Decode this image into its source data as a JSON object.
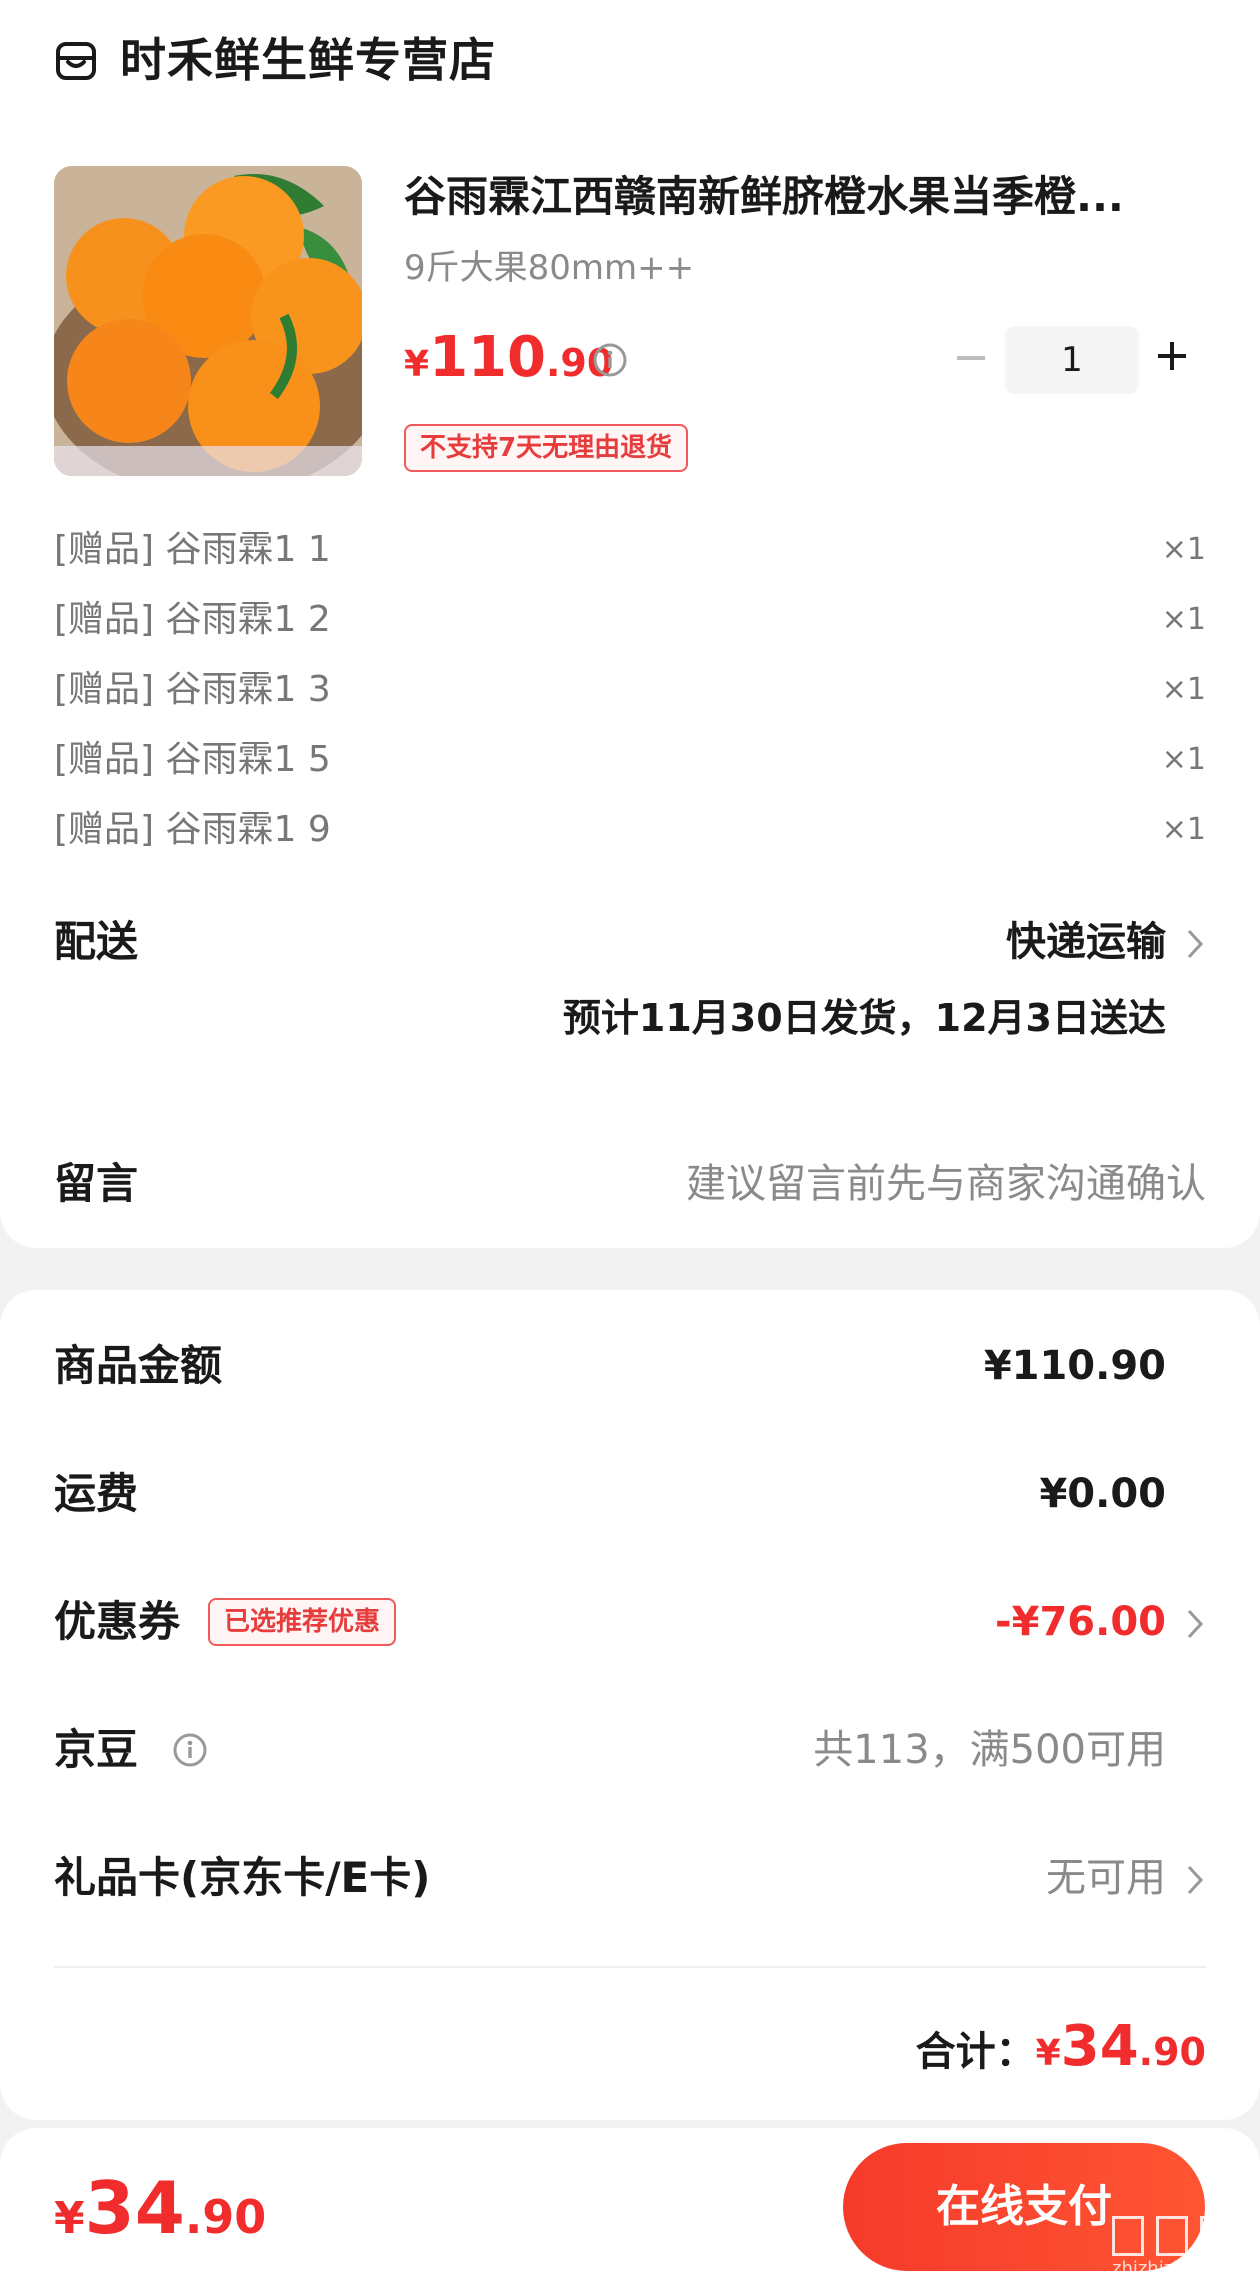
{
  "store": {
    "name": "时禾鲜生鲜专营店"
  },
  "product": {
    "title": "谷雨霖江西赣南新鲜脐橙水果当季橙...",
    "spec": "9斤大果80mm++",
    "price": {
      "currency": "¥",
      "integer": "110",
      "decimal": ".90"
    },
    "quantity": "1",
    "tag": "不支持7天无理由退货"
  },
  "gifts": [
    {
      "label": "[赠品] 谷雨霖1 1",
      "qty": "×1"
    },
    {
      "label": "[赠品] 谷雨霖1 2",
      "qty": "×1"
    },
    {
      "label": "[赠品] 谷雨霖1 3",
      "qty": "×1"
    },
    {
      "label": "[赠品] 谷雨霖1 5",
      "qty": "×1"
    },
    {
      "label": "[赠品] 谷雨霖1 9",
      "qty": "×1"
    }
  ],
  "delivery": {
    "label": "配送",
    "method": "快递运输",
    "estimate": "预计11月30日发货，12月3日送达"
  },
  "message": {
    "label": "留言",
    "placeholder": "建议留言前先与商家沟通确认"
  },
  "summary": {
    "goods_label": "商品金额",
    "goods_value": "¥110.90",
    "shipping_label": "运费",
    "shipping_value": "¥0.00",
    "coupon_label": "优惠券",
    "coupon_tag": "已选推荐优惠",
    "coupon_value": "-¥76.00",
    "beans_label": "京豆",
    "beans_value": "共113，满500可用",
    "giftcard_label": "礼品卡(京东卡/E卡)",
    "giftcard_value": "无可用",
    "total_label": "合计：",
    "total": {
      "currency": "¥",
      "integer": "34",
      "decimal": ".90"
    }
  },
  "bottom": {
    "total": {
      "currency": "¥",
      "integer": "34",
      "decimal": ".90"
    },
    "pay_label": "在线支付"
  },
  "watermark": {
    "domain": "zhizhizhi.com"
  },
  "colors": {
    "accent": "#f02c2c",
    "pay_button": "#f53a2a"
  }
}
